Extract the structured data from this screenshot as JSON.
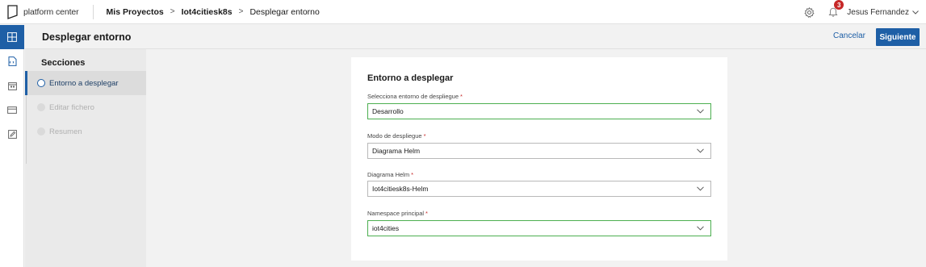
{
  "topbar": {
    "logo_text": "platform center",
    "breadcrumb": [
      "Mis Proyectos",
      "Iot4citiesk8s",
      "Desplegar entorno"
    ],
    "breadcrumb_separator": ">",
    "notification_count": "3",
    "user_name": "Jesus Fernandez",
    "icons": [
      "settings-gear-icon",
      "bell-icon",
      "chevron-down-icon"
    ]
  },
  "rail": {
    "items": [
      {
        "icon": "dashboard-grid-icon",
        "active": true
      },
      {
        "icon": "file-code-icon",
        "active": false
      },
      {
        "icon": "calendar-icon",
        "active": false
      },
      {
        "icon": "card-icon",
        "active": false
      },
      {
        "icon": "edit-icon",
        "active": false
      }
    ]
  },
  "header": {
    "title": "Desplegar entorno",
    "cancel_label": "Cancelar",
    "next_label": "Siguiente"
  },
  "sections": {
    "title": "Secciones",
    "steps": [
      {
        "label": "Entorno a desplegar",
        "state": "active"
      },
      {
        "label": "Editar fichero",
        "state": "disabled"
      },
      {
        "label": "Resumen",
        "state": "disabled"
      }
    ]
  },
  "form": {
    "title": "Entorno a desplegar",
    "required_marker": "*",
    "fields": [
      {
        "label": "Selecciona entorno de despliegue",
        "value": "Desarrollo",
        "valid": true
      },
      {
        "label": "Modo de despliegue",
        "value": "Diagrama Helm",
        "valid": false
      },
      {
        "label": "Diagrama Helm",
        "value": "Iot4citiesk8s-Helm",
        "valid": false
      },
      {
        "label": "Namespace principal",
        "value": "iot4cities",
        "valid": true
      }
    ]
  },
  "colors": {
    "accent": "#1e5fa6",
    "valid_border": "#4caf50",
    "required": "#c62828",
    "badge": "#c62828"
  }
}
